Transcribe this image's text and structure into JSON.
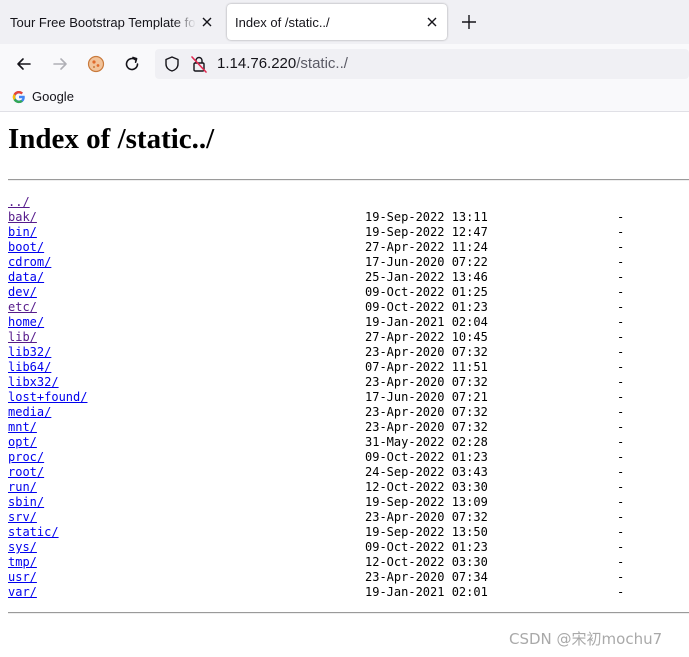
{
  "browser": {
    "tabs": [
      {
        "title": "Tour Free Bootstrap Template for",
        "active": false
      },
      {
        "title": "Index of /static../",
        "active": true
      }
    ],
    "url": {
      "host": "1.14.76.220",
      "path": "/static../"
    },
    "bookmarks": [
      {
        "label": "Google",
        "icon": "google-g-icon"
      }
    ]
  },
  "page": {
    "title": "Index of /static../",
    "parent_link": "../",
    "entries": [
      {
        "name": "bak/",
        "date": "19-Sep-2022 13:11",
        "size": "-"
      },
      {
        "name": "bin/",
        "date": "19-Sep-2022 12:47",
        "size": "-"
      },
      {
        "name": "boot/",
        "date": "27-Apr-2022 11:24",
        "size": "-"
      },
      {
        "name": "cdrom/",
        "date": "17-Jun-2020 07:22",
        "size": "-"
      },
      {
        "name": "data/",
        "date": "25-Jan-2022 13:46",
        "size": "-"
      },
      {
        "name": "dev/",
        "date": "09-Oct-2022 01:25",
        "size": "-"
      },
      {
        "name": "etc/",
        "date": "09-Oct-2022 01:23",
        "size": "-"
      },
      {
        "name": "home/",
        "date": "19-Jan-2021 02:04",
        "size": "-"
      },
      {
        "name": "lib/",
        "date": "27-Apr-2022 10:45",
        "size": "-"
      },
      {
        "name": "lib32/",
        "date": "23-Apr-2020 07:32",
        "size": "-"
      },
      {
        "name": "lib64/",
        "date": "07-Apr-2022 11:51",
        "size": "-"
      },
      {
        "name": "libx32/",
        "date": "23-Apr-2020 07:32",
        "size": "-"
      },
      {
        "name": "lost+found/",
        "date": "17-Jun-2020 07:21",
        "size": "-"
      },
      {
        "name": "media/",
        "date": "23-Apr-2020 07:32",
        "size": "-"
      },
      {
        "name": "mnt/",
        "date": "23-Apr-2020 07:32",
        "size": "-"
      },
      {
        "name": "opt/",
        "date": "31-May-2022 02:28",
        "size": "-"
      },
      {
        "name": "proc/",
        "date": "09-Oct-2022 01:23",
        "size": "-"
      },
      {
        "name": "root/",
        "date": "24-Sep-2022 03:43",
        "size": "-"
      },
      {
        "name": "run/",
        "date": "12-Oct-2022 03:30",
        "size": "-"
      },
      {
        "name": "sbin/",
        "date": "19-Sep-2022 13:09",
        "size": "-"
      },
      {
        "name": "srv/",
        "date": "23-Apr-2020 07:32",
        "size": "-"
      },
      {
        "name": "static/",
        "date": "19-Sep-2022 13:50",
        "size": "-"
      },
      {
        "name": "sys/",
        "date": "09-Oct-2022 01:23",
        "size": "-"
      },
      {
        "name": "tmp/",
        "date": "12-Oct-2022 03:30",
        "size": "-"
      },
      {
        "name": "usr/",
        "date": "23-Apr-2020 07:34",
        "size": "-"
      },
      {
        "name": "var/",
        "date": "19-Jan-2021 02:01",
        "size": "-"
      }
    ]
  },
  "watermark": "CSDN @宋初mochu7",
  "colors": {
    "link": "#0000ee",
    "visited_link": "#551a8b",
    "tab_strip": "#f0f0f4",
    "toolbar": "#f9f9fb",
    "watermark": "#a9a9a9"
  }
}
